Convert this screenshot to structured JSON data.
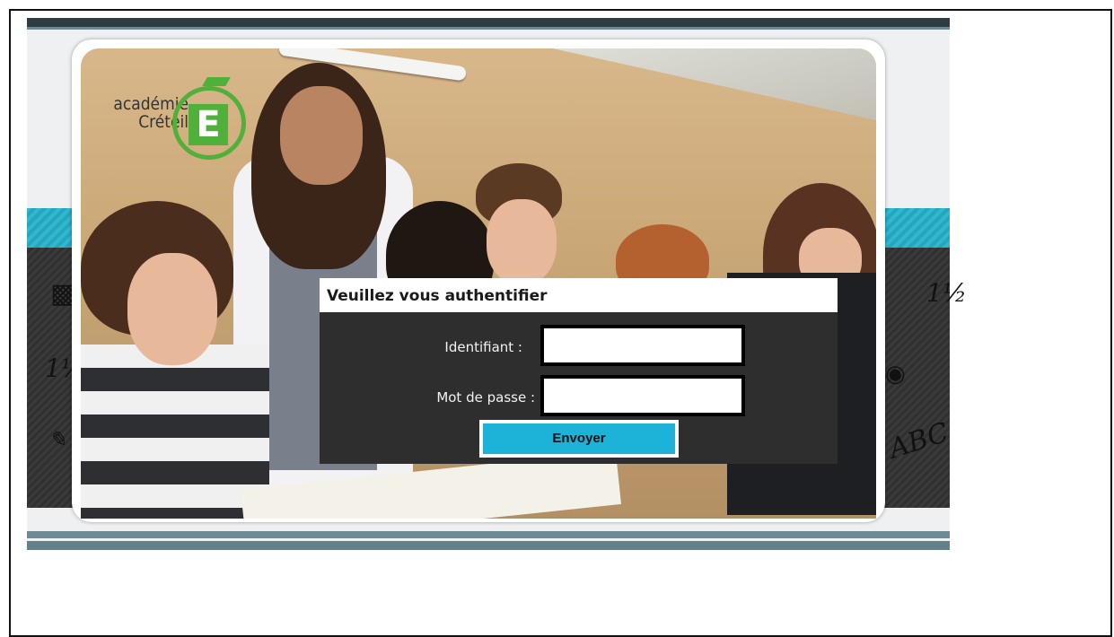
{
  "logo": {
    "line1": "académie",
    "line2": "Créteil",
    "letter": "E"
  },
  "login": {
    "title": "Veuillez vous authentifier",
    "username_label": "Identifiant :",
    "username_value": "",
    "password_label": "Mot de passe :",
    "password_value": "",
    "submit_label": "Envoyer"
  },
  "doodles": {
    "abc": "ABC"
  },
  "colors": {
    "accent": "#1db2d8",
    "logo_green": "#4fb13a",
    "panel": "#2e2e2e",
    "topbar": "#2c3d43"
  }
}
